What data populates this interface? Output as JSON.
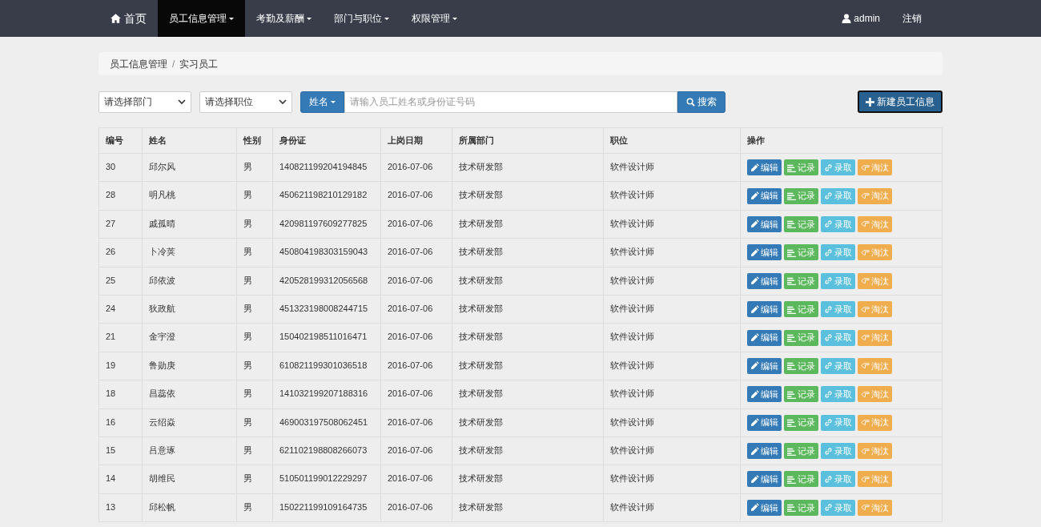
{
  "navbar": {
    "home": "首页",
    "items": [
      {
        "label": "员工信息管理",
        "selected": true
      },
      {
        "label": "考勤及薪酬",
        "selected": false
      },
      {
        "label": "部门与职位",
        "selected": false
      },
      {
        "label": "权限管理",
        "selected": false
      }
    ],
    "user": "admin",
    "logout": "注销"
  },
  "breadcrumb": {
    "items": [
      "员工信息管理",
      "实习员工"
    ],
    "separator": "/"
  },
  "filters": {
    "department": "请选择部门",
    "position": "请选择职位",
    "search_type": "姓名",
    "search_placeholder": "请输入员工姓名或身份证号码",
    "search_button": "搜索",
    "new_button": "新建员工信息"
  },
  "table": {
    "columns": [
      "编号",
      "姓名",
      "性别",
      "身份证",
      "上岗日期",
      "所属部门",
      "职位",
      "操作"
    ],
    "rows": [
      {
        "id": "30",
        "name": "邱尔风",
        "gender": "男",
        "id_card": "140821199204194845",
        "date": "2016-07-06",
        "department": "技术研发部",
        "position": "软件设计师",
        "actions": [
          {
            "kind": "edit",
            "label": "编辑"
          },
          {
            "kind": "record",
            "label": "记录"
          },
          {
            "kind": "hire",
            "label": "录取"
          },
          {
            "kind": "dismiss",
            "label": "淘汰"
          }
        ]
      },
      {
        "id": "28",
        "name": "明凡桃",
        "gender": "男",
        "id_card": "450621198210129182",
        "date": "2016-07-06",
        "department": "技术研发部",
        "position": "软件设计师",
        "actions": [
          {
            "kind": "edit",
            "label": "编辑"
          },
          {
            "kind": "record",
            "label": "记录"
          },
          {
            "kind": "hire",
            "label": "录取"
          },
          {
            "kind": "dismiss",
            "label": "淘汰"
          }
        ]
      },
      {
        "id": "27",
        "name": "戚孤晴",
        "gender": "男",
        "id_card": "420981197609277825",
        "date": "2016-07-06",
        "department": "技术研发部",
        "position": "软件设计师",
        "actions": [
          {
            "kind": "edit",
            "label": "编辑"
          },
          {
            "kind": "record",
            "label": "记录"
          },
          {
            "kind": "hire",
            "label": "录取"
          },
          {
            "kind": "dismiss",
            "label": "淘汰"
          }
        ]
      },
      {
        "id": "26",
        "name": "卜冷荚",
        "gender": "男",
        "id_card": "450804198303159043",
        "date": "2016-07-06",
        "department": "技术研发部",
        "position": "软件设计师",
        "actions": [
          {
            "kind": "edit",
            "label": "编辑"
          },
          {
            "kind": "record",
            "label": "记录"
          },
          {
            "kind": "hire",
            "label": "录取"
          },
          {
            "kind": "dismiss",
            "label": "淘汰"
          }
        ]
      },
      {
        "id": "25",
        "name": "邱依波",
        "gender": "男",
        "id_card": "420528199312056568",
        "date": "2016-07-06",
        "department": "技术研发部",
        "position": "软件设计师",
        "actions": [
          {
            "kind": "edit",
            "label": "编辑"
          },
          {
            "kind": "record",
            "label": "记录"
          },
          {
            "kind": "hire",
            "label": "录取"
          },
          {
            "kind": "dismiss",
            "label": "淘汰"
          }
        ]
      },
      {
        "id": "24",
        "name": "狄政航",
        "gender": "男",
        "id_card": "451323198008244715",
        "date": "2016-07-06",
        "department": "技术研发部",
        "position": "软件设计师",
        "actions": [
          {
            "kind": "edit",
            "label": "编辑"
          },
          {
            "kind": "record",
            "label": "记录"
          },
          {
            "kind": "hire",
            "label": "录取"
          },
          {
            "kind": "dismiss",
            "label": "淘汰"
          }
        ]
      },
      {
        "id": "21",
        "name": "金宇澄",
        "gender": "男",
        "id_card": "150402198511016471",
        "date": "2016-07-06",
        "department": "技术研发部",
        "position": "软件设计师",
        "actions": [
          {
            "kind": "edit",
            "label": "编辑"
          },
          {
            "kind": "record",
            "label": "记录"
          },
          {
            "kind": "hire",
            "label": "录取"
          },
          {
            "kind": "dismiss",
            "label": "淘汰"
          }
        ]
      },
      {
        "id": "19",
        "name": "鲁勋庚",
        "gender": "男",
        "id_card": "610821199301036518",
        "date": "2016-07-06",
        "department": "技术研发部",
        "position": "软件设计师",
        "actions": [
          {
            "kind": "edit",
            "label": "编辑"
          },
          {
            "kind": "record",
            "label": "记录"
          },
          {
            "kind": "hire",
            "label": "录取"
          },
          {
            "kind": "dismiss",
            "label": "淘汰"
          }
        ]
      },
      {
        "id": "18",
        "name": "昌蕊依",
        "gender": "男",
        "id_card": "141032199207188316",
        "date": "2016-07-06",
        "department": "技术研发部",
        "position": "软件设计师",
        "actions": [
          {
            "kind": "edit",
            "label": "编辑"
          },
          {
            "kind": "record",
            "label": "记录"
          },
          {
            "kind": "hire",
            "label": "录取"
          },
          {
            "kind": "dismiss",
            "label": "淘汰"
          }
        ]
      },
      {
        "id": "16",
        "name": "云绍焱",
        "gender": "男",
        "id_card": "469003197508062451",
        "date": "2016-07-06",
        "department": "技术研发部",
        "position": "软件设计师",
        "actions": [
          {
            "kind": "edit",
            "label": "编辑"
          },
          {
            "kind": "record",
            "label": "记录"
          },
          {
            "kind": "hire",
            "label": "录取"
          },
          {
            "kind": "dismiss",
            "label": "淘汰"
          }
        ]
      },
      {
        "id": "15",
        "name": "吕意琢",
        "gender": "男",
        "id_card": "621102198808266073",
        "date": "2016-07-06",
        "department": "技术研发部",
        "position": "软件设计师",
        "actions": [
          {
            "kind": "edit",
            "label": "编辑"
          },
          {
            "kind": "record",
            "label": "记录"
          },
          {
            "kind": "hire",
            "label": "录取"
          },
          {
            "kind": "dismiss",
            "label": "淘汰"
          }
        ]
      },
      {
        "id": "14",
        "name": "胡维民",
        "gender": "男",
        "id_card": "510501199012229297",
        "date": "2016-07-06",
        "department": "技术研发部",
        "position": "软件设计师",
        "actions": [
          {
            "kind": "edit",
            "label": "编辑"
          },
          {
            "kind": "record",
            "label": "记录"
          },
          {
            "kind": "hire",
            "label": "录取"
          },
          {
            "kind": "dismiss",
            "label": "淘汰"
          }
        ]
      },
      {
        "id": "13",
        "name": "邱松帆",
        "gender": "男",
        "id_card": "150221199109164735",
        "date": "2016-07-06",
        "department": "技术研发部",
        "position": "软件设计师",
        "actions": [
          {
            "kind": "edit",
            "label": "编辑"
          },
          {
            "kind": "record",
            "label": "记录"
          },
          {
            "kind": "hire",
            "label": "录取"
          },
          {
            "kind": "dismiss",
            "label": "淘汰"
          }
        ]
      }
    ]
  }
}
